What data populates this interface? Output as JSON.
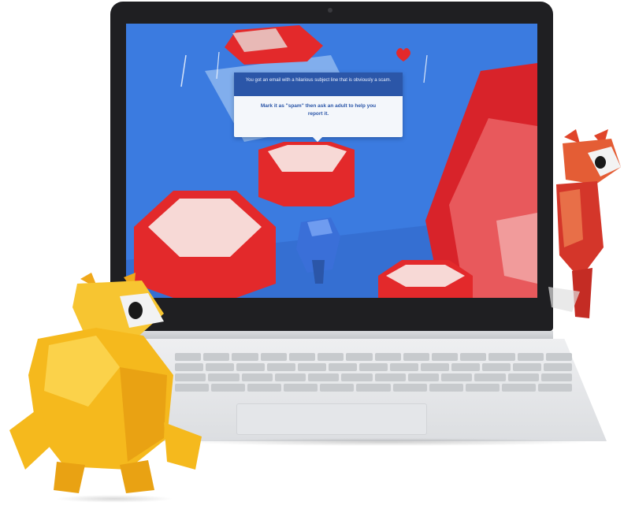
{
  "scene": {
    "device": "laptop",
    "dialog": {
      "header_text": "You got an email with a hilarious subject line that is obviously a scam.",
      "body_text": "Mark it as \"spam\" then ask an adult to help you report it."
    },
    "characters": [
      "blue-robot-character",
      "yellow-robot-character",
      "red-fox-character"
    ],
    "icons": [
      "heart-icon"
    ]
  },
  "colors": {
    "screen_background": "#3b7be0",
    "hexagon_red": "#e3292b",
    "hexagon_top": "#f7d9d6",
    "dialog_header": "#2b56a8",
    "yellow_character": "#f5b91d",
    "red_character": "#e0442a",
    "blue_character": "#3a6fd8"
  }
}
